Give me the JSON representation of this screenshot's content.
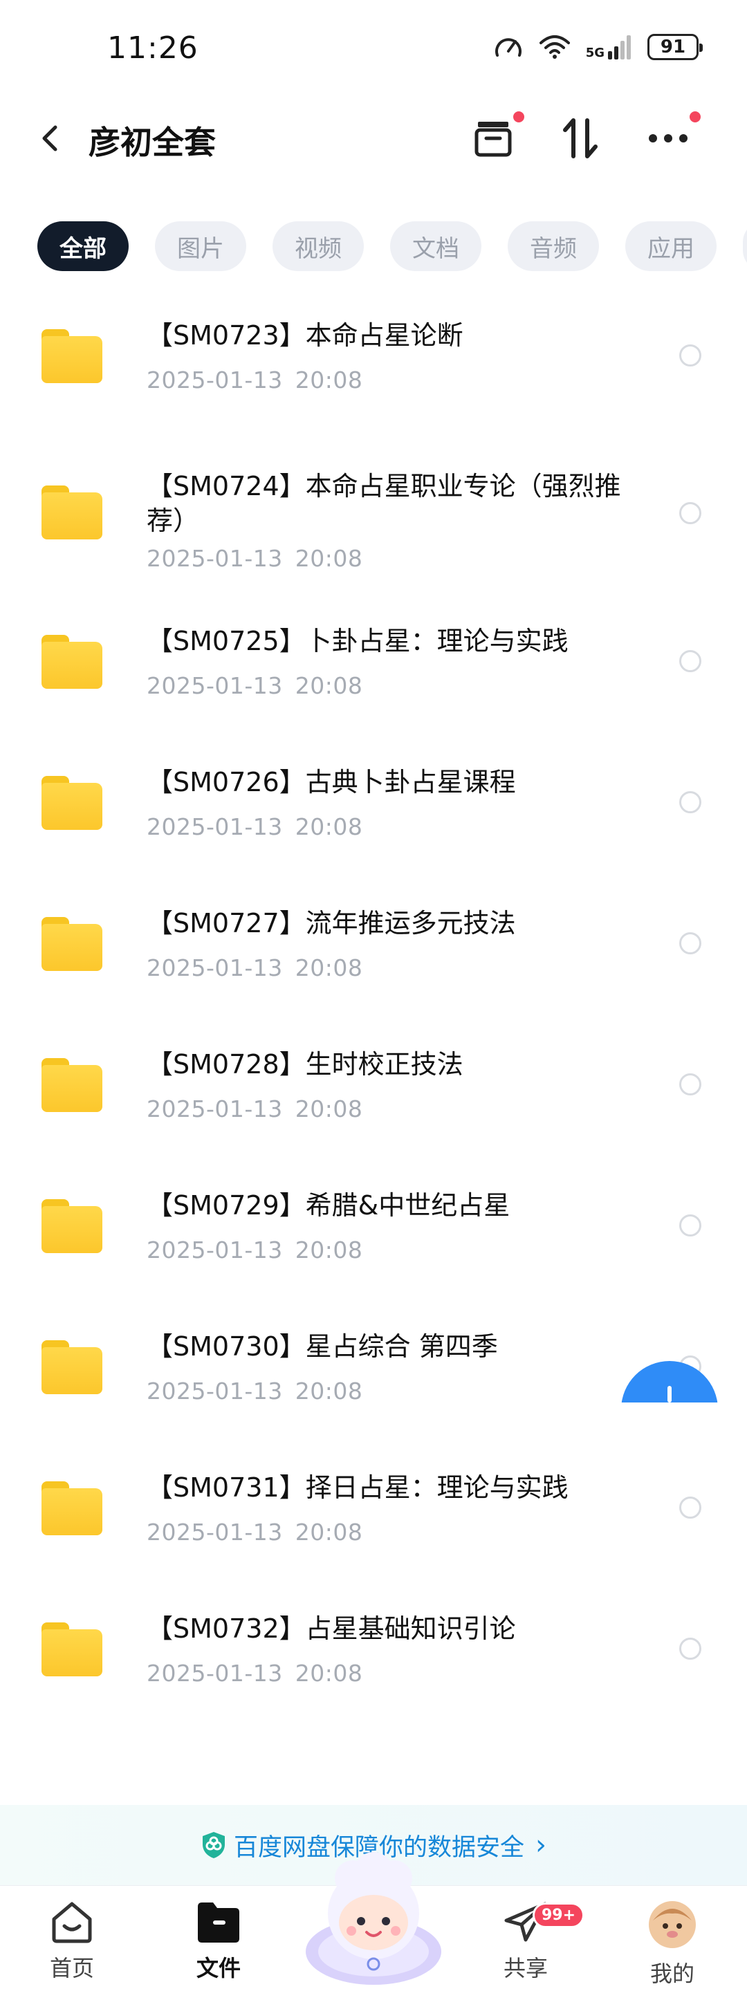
{
  "status_bar": {
    "time": "11:26",
    "network": "5G",
    "battery": "91",
    "icons": [
      "speed-icon",
      "wifi-icon",
      "signal-icon",
      "battery-icon"
    ]
  },
  "header": {
    "title": "彦初全套",
    "buttons": [
      "archive-icon",
      "sort-icon",
      "more-icon"
    ]
  },
  "tabs": [
    {
      "label": "全部",
      "active": true
    },
    {
      "label": "图片",
      "active": false
    },
    {
      "label": "视频",
      "active": false
    },
    {
      "label": "文档",
      "active": false
    },
    {
      "label": "音频",
      "active": false
    },
    {
      "label": "应用",
      "active": false
    }
  ],
  "files": [
    {
      "name": "【SM0723】本命占星论断",
      "date": "2025-01-13",
      "time": "20:08"
    },
    {
      "name": "【SM0724】本命占星职业专论（强烈推荐）",
      "date": "2025-01-13",
      "time": "20:08"
    },
    {
      "name": "【SM0725】卜卦占星：理论与实践",
      "date": "2025-01-13",
      "time": "20:08"
    },
    {
      "name": "【SM0726】古典卜卦占星课程",
      "date": "2025-01-13",
      "time": "20:08"
    },
    {
      "name": "【SM0727】流年推运多元技法",
      "date": "2025-01-13",
      "time": "20:08"
    },
    {
      "name": "【SM0728】生时校正技法",
      "date": "2025-01-13",
      "time": "20:08"
    },
    {
      "name": "【SM0729】希腊&中世纪占星",
      "date": "2025-01-13",
      "time": "20:08"
    },
    {
      "name": "【SM0730】星占综合 第四季",
      "date": "2025-01-13",
      "time": "20:08"
    },
    {
      "name": "【SM0731】择日占星：理论与实践",
      "date": "2025-01-13",
      "time": "20:08"
    },
    {
      "name": "【SM0732】占星基础知识引论",
      "date": "2025-01-13",
      "time": "20:08"
    }
  ],
  "safety_banner": {
    "text": "百度网盘保障你的数据安全",
    "icon": "shield-icon"
  },
  "bottom_nav": {
    "home": "首页",
    "files": "文件",
    "share": "共享",
    "share_badge": "99+",
    "mine": "我的"
  },
  "colors": {
    "accent": "#2f8cf7",
    "active_tab": "#121c2b",
    "badge": "#f4455d",
    "folder": "#fcc72c"
  }
}
